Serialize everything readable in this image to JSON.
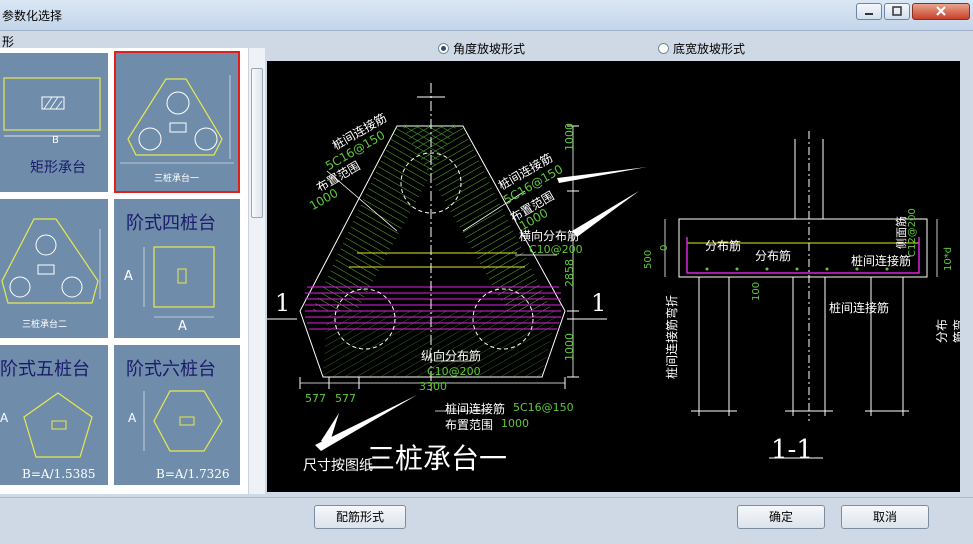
{
  "window": {
    "title": "参数化选择",
    "subtitle": "形"
  },
  "thumbnails": [
    {
      "caption": "矩形承台",
      "label_b": "B"
    },
    {
      "caption": "三桩承台一",
      "selected": true
    },
    {
      "caption": "三桩承台二"
    },
    {
      "caption": "阶式四桩台",
      "label_a": "A",
      "label_a2": "A"
    },
    {
      "caption": "阶式五桩台",
      "label_a": "A",
      "formula": "B=A/1.5385"
    },
    {
      "caption": "阶式六桩台",
      "label_a": "A",
      "formula": "B=A/1.7326"
    }
  ],
  "options": {
    "angle": "角度放坡形式",
    "bottom": "底宽放坡形式",
    "selected": "angle"
  },
  "drawing": {
    "title": "三桩承台一",
    "section_mark": "1",
    "section_label": "1-1",
    "note": "尺寸按图纸",
    "pile_bar": "桩间连接筋",
    "pile_bar_spec_left": "5C16@150",
    "pile_bar_spec_right": "5C16@150",
    "pile_bar_spec_bottom": "5C16@150",
    "range": "布置范围",
    "range_val": "1000",
    "h_dist": "横向分布筋",
    "h_dist_spec": "C10@200",
    "v_dist": "纵向分布筋",
    "v_dist_spec": "C10@200",
    "dim_total": "3300",
    "dim_577a": "577",
    "dim_577b": "577",
    "dim_1000a": "1000",
    "dim_2858": "2858",
    "dim_1000b": "1000",
    "sec_dist1": "分布筋",
    "sec_dist2": "分布筋",
    "sec_pile_bar": "桩间连接筋",
    "sec_pile_bar2": "桩间连接筋",
    "sec_side_bar": "侧面筋",
    "sec_side_spec": "C12@200",
    "sec_500": "500",
    "sec_0": "0",
    "sec_100": "100",
    "sec_10d": "10*d",
    "sec_pile_bend": "桩间连接筋弯折",
    "sec_dist_bend": "分布筋弯折"
  },
  "buttons": {
    "rebar_form": "配筋形式",
    "ok": "确定",
    "cancel": "取消"
  }
}
